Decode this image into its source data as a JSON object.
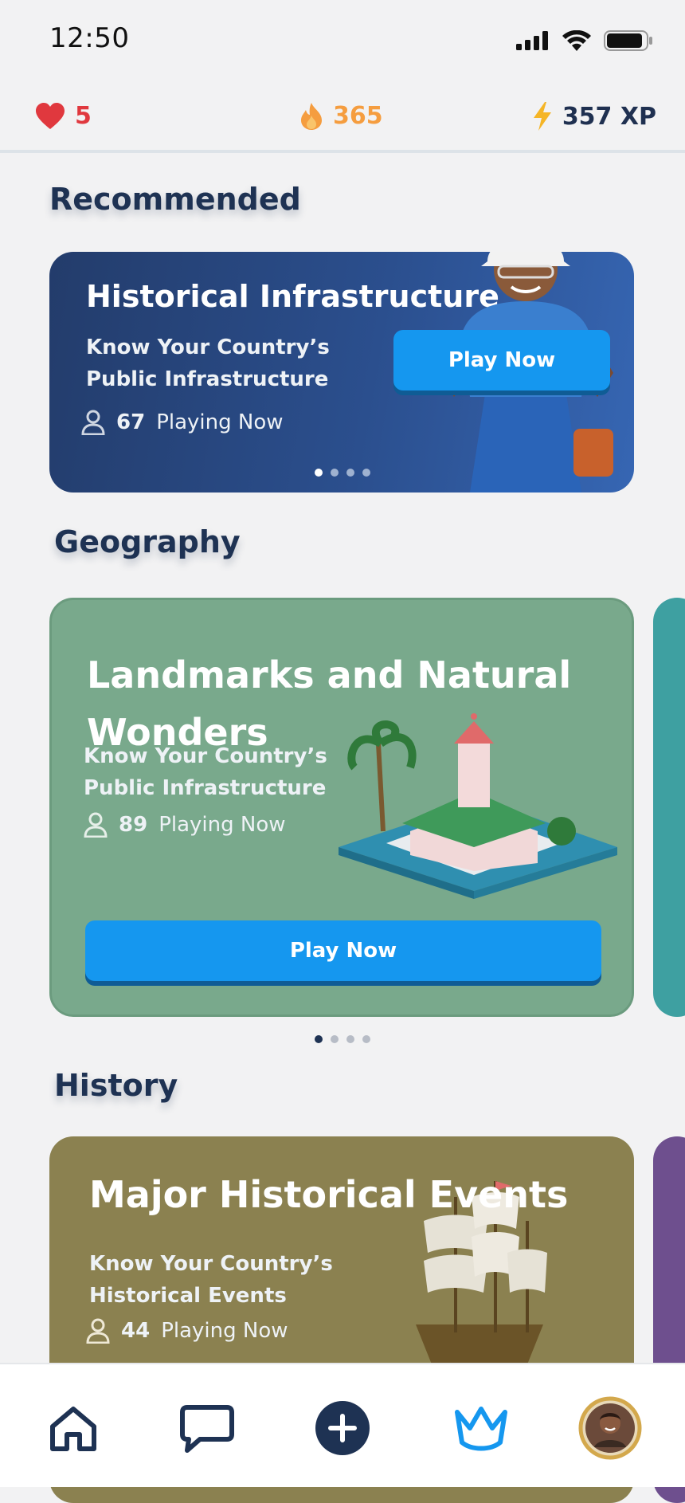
{
  "status_bar": {
    "time": "12:50"
  },
  "stats": {
    "hearts": "5",
    "streak": "365",
    "xp": "357 XP"
  },
  "recommended": {
    "section_title": "Recommended",
    "card": {
      "title": "Historical Infrastructure",
      "subtitle_line1": "Know Your Country’s",
      "subtitle_line2": "Public Infrastructure",
      "players_count": "67",
      "players_label": "Playing Now",
      "button_label": "Play Now",
      "pager_active": 0,
      "pager_total": 4
    }
  },
  "geography": {
    "section_title": "Geography",
    "card": {
      "title_line1": "Landmarks and Natural",
      "title_line2": "Wonders",
      "subtitle_line1": "Know Your Country’s",
      "subtitle_line2": "Public Infrastructure",
      "players_count": "89",
      "players_label": "Playing Now",
      "button_label": "Play Now"
    },
    "pager_active": 0,
    "pager_total": 4
  },
  "history": {
    "section_title": "History",
    "card": {
      "title": "Major Historical Events",
      "subtitle_line1": "Know Your Country’s",
      "subtitle_line2": "Historical Events",
      "players_count": "44",
      "players_label": "Playing Now"
    }
  },
  "bottom_nav": {
    "items": [
      "home-icon",
      "chat-icon",
      "add-icon",
      "crown-icon",
      "profile-avatar"
    ]
  },
  "colors": {
    "primary_button": "#1597ef",
    "heading": "#1e3253",
    "heart": "#e0383e",
    "streak": "#f59d3f",
    "xp_bolt": "#f5b526"
  }
}
